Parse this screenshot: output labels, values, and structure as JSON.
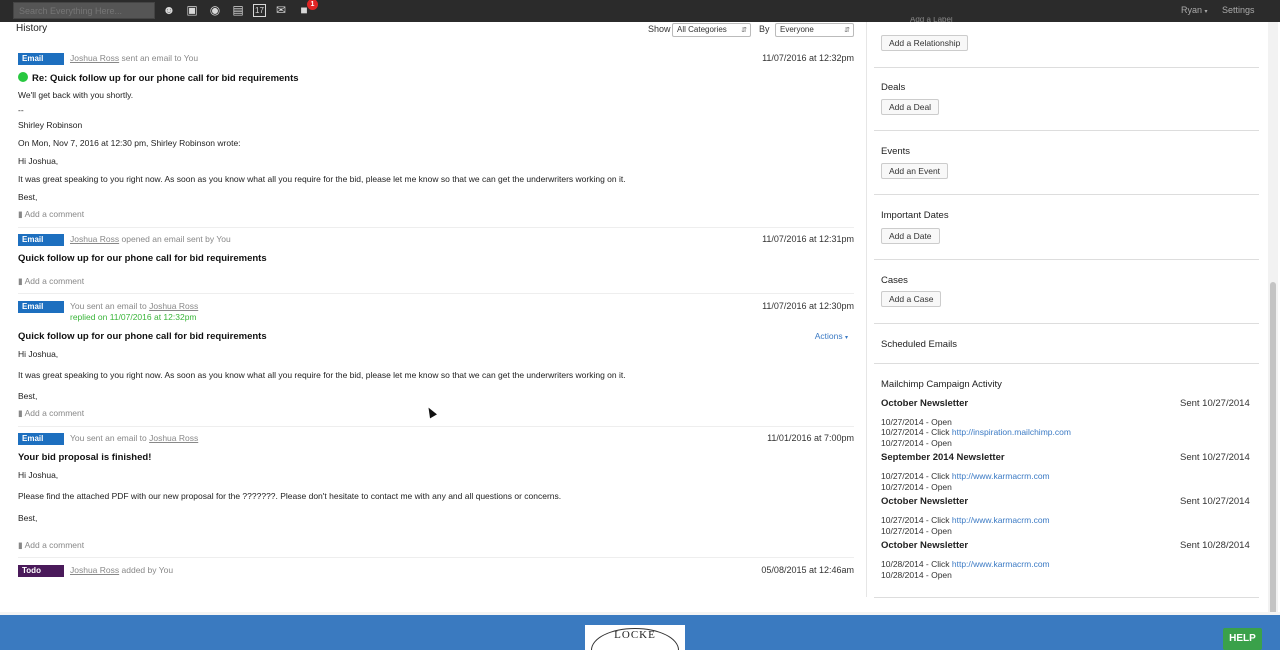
{
  "topbar": {
    "search_placeholder": "Search Everything Here...",
    "icons": [
      "person-icon",
      "buildings-icon",
      "money-bag-icon",
      "inbox-icon",
      "calendar-icon",
      "mail-icon",
      "chat-icon"
    ],
    "calendar_day": "17",
    "notification_count": "1",
    "user": "Ryan",
    "settings": "Settings"
  },
  "history": {
    "title": "History",
    "show_label": "Show",
    "show_value": "All Categories",
    "by_label": "By",
    "by_value": "Everyone"
  },
  "items": [
    {
      "badge": "Email",
      "actor": "Joshua Ross",
      "action": "sent an email to You",
      "time": "11/07/2016 at 12:32pm",
      "subject": "Re: Quick follow up for our phone call for bid requirements",
      "lines": [
        "We'll get back with you shortly.",
        "--",
        "Shirley Robinson",
        "On Mon, Nov 7, 2016 at 12:30 pm, Shirley Robinson wrote:",
        "Hi Joshua,",
        "It was great speaking to you right now. As soon as you know what all you require for the bid, please let me know so that we can get the underwriters working on it.",
        "Best,"
      ],
      "comment": "Add a comment"
    },
    {
      "badge": "Email",
      "actor": "Joshua Ross",
      "action": "opened an email sent by You",
      "time": "11/07/2016 at 12:31pm",
      "subject": "Quick follow up for our phone call for bid requirements",
      "comment": "Add a comment"
    },
    {
      "badge": "Email",
      "prefix": "You sent an email to",
      "actor": "Joshua Ross",
      "replied": "replied on 11/07/2016 at 12:32pm",
      "time": "11/07/2016 at 12:30pm",
      "subject": "Quick follow up for our phone call for bid requirements",
      "actions": "Actions",
      "lines": [
        "Hi Joshua,",
        "It was great speaking to you right now. As soon as you know what all you require for the bid, please let me know so that we can get the underwriters working on it.",
        "Best,"
      ],
      "comment": "Add a comment"
    },
    {
      "badge": "Email",
      "prefix": "You sent an email to",
      "actor": "Joshua Ross",
      "time": "11/01/2016 at 7:00pm",
      "subject": "Your bid proposal is finished!",
      "lines": [
        "Hi Joshua,",
        "Please find the attached PDF with our new proposal for the ???????. Please don't hesitate to contact me with any and all questions or concerns.",
        "Best,"
      ],
      "comment": "Add a comment"
    },
    {
      "badge": "Todo",
      "actor": "Joshua Ross",
      "action": "added by You",
      "time": "05/08/2015 at 12:46am"
    }
  ],
  "sidebar": {
    "add_label_partial": "Add a Label",
    "add_relationship": "Add a Relationship",
    "deals_title": "Deals",
    "add_deal": "Add a Deal",
    "events_title": "Events",
    "add_event": "Add an Event",
    "dates_title": "Important Dates",
    "add_date": "Add a Date",
    "cases_title": "Cases",
    "add_case": "Add a Case",
    "scheduled_title": "Scheduled Emails",
    "mailchimp_title": "Mailchimp Campaign Activity",
    "campaigns": [
      {
        "name": "October Newsletter",
        "sent": "Sent 10/27/2014",
        "lines": [
          {
            "text": "10/27/2014 - Open",
            "link": ""
          },
          {
            "text": "10/27/2014 - Click ",
            "link": "http://inspiration.mailchimp.com"
          },
          {
            "text": "10/27/2014 - Open",
            "link": ""
          }
        ]
      },
      {
        "name": "September 2014 Newsletter",
        "sent": "Sent 10/27/2014",
        "lines": [
          {
            "text": "10/27/2014 - Click ",
            "link": "http://www.karmacrm.com"
          },
          {
            "text": "10/27/2014 - Open",
            "link": ""
          }
        ]
      },
      {
        "name": "October Newsletter",
        "sent": "Sent 10/27/2014",
        "lines": [
          {
            "text": "10/27/2014 - Click ",
            "link": "http://www.karmacrm.com"
          },
          {
            "text": "10/27/2014 - Open",
            "link": ""
          }
        ]
      },
      {
        "name": "October Newsletter",
        "sent": "Sent 10/28/2014",
        "lines": [
          {
            "text": "10/28/2014 - Click ",
            "link": "http://www.karmacrm.com"
          },
          {
            "text": "10/28/2014 - Open",
            "link": ""
          }
        ]
      }
    ]
  },
  "footer": {
    "logo_text": "LOCKE",
    "help": "HELP"
  }
}
